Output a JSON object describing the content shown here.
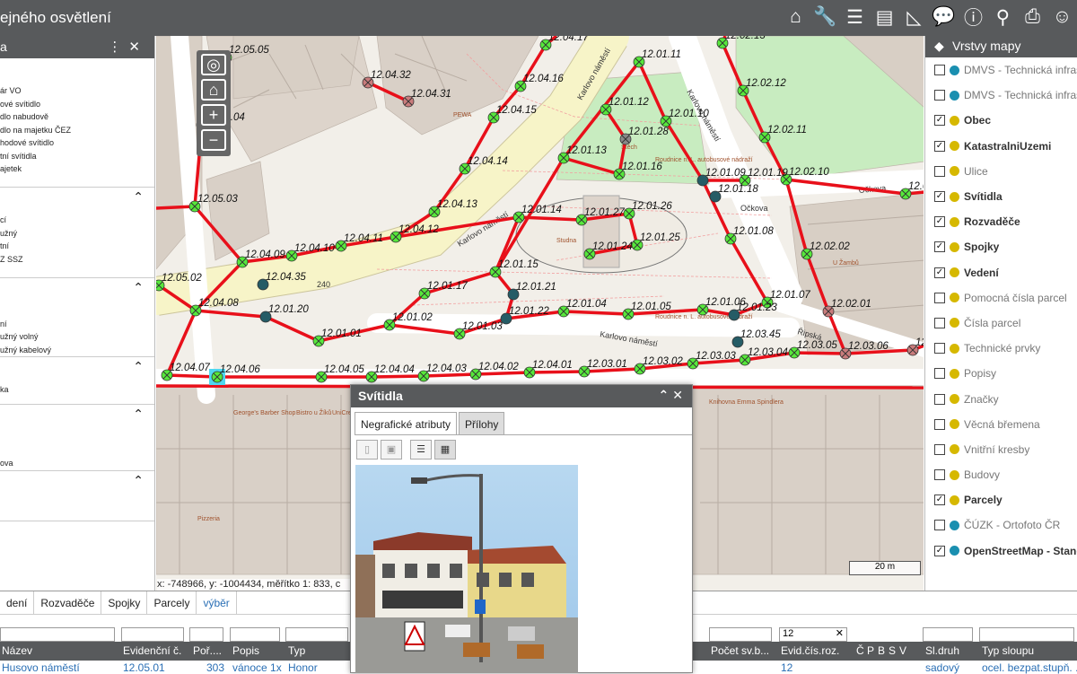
{
  "app": {
    "title": "ejného osvětlení"
  },
  "toolbar": [
    "home-icon",
    "wrench-icon",
    "layers-icon",
    "list-icon",
    "ruler-icon",
    "comment-icon",
    "info-icon",
    "search-icon",
    "print-icon",
    "user-icon"
  ],
  "left_panel": {
    "header": "a",
    "sections": [
      {
        "lines": [
          "",
          "",
          "ár VO",
          "ové svítidlo",
          "dlo nabudově",
          "dlo na majetku ČEZ",
          "hodové svítidlo",
          "tní svítidla",
          "ajetek"
        ]
      },
      {
        "lines": [
          "",
          "",
          "cí",
          "užný",
          "tní",
          "Z SSZ"
        ]
      },
      {
        "lines": [
          "",
          "",
          "",
          "ní",
          "užný volný",
          "užný kabelový"
        ]
      },
      {
        "lines": [
          "",
          "",
          "ka"
        ]
      },
      {
        "lines": [
          "",
          "",
          "",
          "",
          "ova"
        ]
      },
      {
        "lines": [
          ""
        ]
      }
    ]
  },
  "map": {
    "coords": "x: -748966, y: -1004434, měřítko 1: 833, c",
    "scale": "20 m",
    "road_label": "240",
    "streets": [
      "Karlovo náměstí",
      "Karlovo náměstí",
      "Karlovo náměstí",
      "Karlovo náměstí",
      "Očkova",
      "Očkova",
      "Řipská"
    ],
    "pois": [
      "PEWA",
      "Štěch",
      "Studna",
      "Roudnice n. L. autobusové nádraží",
      "Roudnice n. L. autobusové nádraží",
      "U Žambů",
      "George's Barber Shop",
      "Bistro u Žíků",
      "UniCredit",
      "Knihovna Emma Spindlera",
      "Pizzeria"
    ],
    "points": [
      {
        "id": "12.05.05",
        "t": "g"
      },
      {
        "id": "12.04.32",
        "t": "r"
      },
      {
        "id": "12.04.31",
        "t": "r"
      },
      {
        "id": "12.04.17",
        "t": "g"
      },
      {
        "id": "12.04.16",
        "t": "g"
      },
      {
        "id": "12.04.15",
        "t": "g"
      },
      {
        "id": "12.05.04",
        "t": "g"
      },
      {
        "id": "12.01.11",
        "t": "g"
      },
      {
        "id": "12.01.12",
        "t": "g"
      },
      {
        "id": "12.01.10",
        "t": "g"
      },
      {
        "id": "12.01.28",
        "t": "d"
      },
      {
        "id": "12.01.13",
        "t": "g"
      },
      {
        "id": "12.01.16",
        "t": "g"
      },
      {
        "id": "12.04.14",
        "t": "g"
      },
      {
        "id": "12.04.13",
        "t": "g"
      },
      {
        "id": "12.05.03",
        "t": "g"
      },
      {
        "id": "12.02.13",
        "t": "g"
      },
      {
        "id": "12.02.12",
        "t": "g"
      },
      {
        "id": "12.02.11",
        "t": "g"
      },
      {
        "id": "12.02.10",
        "t": "g"
      },
      {
        "id": "12.01.09",
        "t": "t"
      },
      {
        "id": "12.01.19",
        "t": "g"
      },
      {
        "id": "12.01.18",
        "t": "t"
      },
      {
        "id": "12.02.03",
        "t": "g"
      },
      {
        "id": "12.01.14",
        "t": "g"
      },
      {
        "id": "12.01.27",
        "t": "g"
      },
      {
        "id": "12.01.26",
        "t": "g"
      },
      {
        "id": "12.01.24",
        "t": "g"
      },
      {
        "id": "12.01.25",
        "t": "g"
      },
      {
        "id": "12.04.12",
        "t": "g"
      },
      {
        "id": "12.04.11",
        "t": "g"
      },
      {
        "id": "12.04.10",
        "t": "g"
      },
      {
        "id": "12.04.09",
        "t": "g"
      },
      {
        "id": "12.04.35",
        "t": "t"
      },
      {
        "id": "12.01.08",
        "t": "g"
      },
      {
        "id": "12.02.02",
        "t": "g"
      },
      {
        "id": "12.05.02",
        "t": "g"
      },
      {
        "id": "12.01.15",
        "t": "g"
      },
      {
        "id": "12.01.17",
        "t": "g"
      },
      {
        "id": "12.01.21",
        "t": "t"
      },
      {
        "id": "12.04.08",
        "t": "g"
      },
      {
        "id": "12.01.20",
        "t": "t"
      },
      {
        "id": "12.01.04",
        "t": "g"
      },
      {
        "id": "12.01.05",
        "t": "g"
      },
      {
        "id": "12.01.06",
        "t": "g"
      },
      {
        "id": "12.01.07",
        "t": "g"
      },
      {
        "id": "12.01.23",
        "t": "t"
      },
      {
        "id": "12.02.01",
        "t": "r"
      },
      {
        "id": "12.01.22",
        "t": "t"
      },
      {
        "id": "12.01.02",
        "t": "g"
      },
      {
        "id": "12.01.03",
        "t": "g"
      },
      {
        "id": "12.01.01",
        "t": "g"
      },
      {
        "id": "12.03.05",
        "t": "g"
      },
      {
        "id": "12.03.06",
        "t": "r"
      },
      {
        "id": "12.03.07",
        "t": "r"
      },
      {
        "id": "12.03.04",
        "t": "g"
      },
      {
        "id": "12.03.03",
        "t": "g"
      },
      {
        "id": "12.03.02",
        "t": "g"
      },
      {
        "id": "12.03.01",
        "t": "g"
      },
      {
        "id": "12.04.01",
        "t": "g"
      },
      {
        "id": "12.04.02",
        "t": "g"
      },
      {
        "id": "12.04.03",
        "t": "g"
      },
      {
        "id": "12.04.04",
        "t": "g"
      },
      {
        "id": "12.04.05",
        "t": "g"
      },
      {
        "id": "12.04.06",
        "t": "s"
      },
      {
        "id": "12.04.07",
        "t": "g"
      },
      {
        "id": "12.03.45",
        "t": "t"
      }
    ]
  },
  "layers_panel": {
    "title": "Vrstvy mapy",
    "layers": [
      {
        "name": "DMVS - Technická infras",
        "checked": false,
        "globe": "#1a8fb0",
        "bold": false
      },
      {
        "name": "DMVS - Technická infras",
        "checked": false,
        "globe": "#1a8fb0",
        "bold": false
      },
      {
        "name": "Obec",
        "checked": true,
        "globe": "#d6b800",
        "bold": true
      },
      {
        "name": "KatastralniUzemi",
        "checked": true,
        "globe": "#d6b800",
        "bold": true
      },
      {
        "name": "Ulice",
        "checked": false,
        "globe": "#d6b800",
        "bold": false
      },
      {
        "name": "Svítidla",
        "checked": true,
        "globe": "#d6b800",
        "bold": true
      },
      {
        "name": "Rozvaděče",
        "checked": true,
        "globe": "#d6b800",
        "bold": true
      },
      {
        "name": "Spojky",
        "checked": true,
        "globe": "#d6b800",
        "bold": true
      },
      {
        "name": "Vedení",
        "checked": true,
        "globe": "#d6b800",
        "bold": true
      },
      {
        "name": "Pomocná čísla parcel",
        "checked": false,
        "globe": "#d6b800",
        "bold": false
      },
      {
        "name": "Čísla parcel",
        "checked": false,
        "globe": "#d6b800",
        "bold": false
      },
      {
        "name": "Technické prvky",
        "checked": false,
        "globe": "#d6b800",
        "bold": false
      },
      {
        "name": "Popisy",
        "checked": false,
        "globe": "#d6b800",
        "bold": false
      },
      {
        "name": "Značky",
        "checked": false,
        "globe": "#d6b800",
        "bold": false
      },
      {
        "name": "Věcná břemena",
        "checked": false,
        "globe": "#d6b800",
        "bold": false
      },
      {
        "name": "Vnitřní kresby",
        "checked": false,
        "globe": "#d6b800",
        "bold": false
      },
      {
        "name": "Budovy",
        "checked": false,
        "globe": "#d6b800",
        "bold": false
      },
      {
        "name": "Parcely",
        "checked": true,
        "globe": "#d6b800",
        "bold": true
      },
      {
        "name": "ČÚZK - Ortofoto ČR",
        "checked": false,
        "globe": "#1a8fb0",
        "bold": false
      },
      {
        "name": "OpenStreetMap - Stand",
        "checked": true,
        "globe": "#1a8fb0",
        "bold": true
      }
    ]
  },
  "bottom": {
    "tabs": [
      "dení",
      "Rozvaděče",
      "Spojky",
      "Parcely",
      "výběr"
    ],
    "filter_value": "12",
    "columns": [
      "Název",
      "Evidenční č.",
      "Poř....",
      "Popis",
      "Typ",
      "Počet sv.b...",
      "Evid.čís.roz.",
      "Č",
      "P",
      "B",
      "S",
      "V",
      "Sl.druh",
      "Typ sloupu"
    ],
    "row": [
      "Husovo náměstí",
      "12.05.01",
      "303",
      "vánoce 1x",
      "Honor",
      "",
      "12",
      "",
      "",
      "",
      "",
      "",
      "sadový",
      "ocel. bezpat.stupň. ..."
    ]
  },
  "popup": {
    "title": "Svítidla",
    "tabs": [
      "Negrafické atributy",
      "Přílohy"
    ],
    "active_tab": 1
  },
  "colors": {
    "header": "#585a5c",
    "line": "#e8101a",
    "point_green": "#57e83c",
    "point_red": "#c97c7c",
    "point_teal": "#255c66",
    "link": "#2a6fb5"
  }
}
